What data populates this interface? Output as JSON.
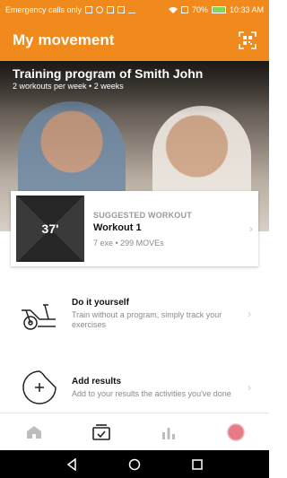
{
  "status_bar": {
    "carrier": "Emergency calls only",
    "battery": "70%",
    "time": "10:33 AM",
    "icons": [
      "usb-icon",
      "cloud-icon",
      "photo-icon",
      "mail-icon",
      "download-icon",
      "wifi-icon",
      "sim-icon",
      "battery-icon"
    ]
  },
  "appbar": {
    "title": "My movement",
    "scan_icon": "qr-scan-icon"
  },
  "hero": {
    "title": "Training program of Smith John",
    "subtitle": "2 workouts per week • 2 weeks"
  },
  "suggested": {
    "duration": "37'",
    "label": "SUGGESTED WORKOUT",
    "name": "Workout 1",
    "meta": "7 exe • 299 MOVEs"
  },
  "options": [
    {
      "title": "Do it yourself",
      "desc": "Train without a program, simply track your exercises",
      "icon": "exercise-bike-icon"
    },
    {
      "title": "Add results",
      "desc": "Add to your results the activities you've done",
      "icon": "add-circle-icon"
    }
  ],
  "tabs": [
    {
      "icon": "home-icon"
    },
    {
      "icon": "workout-icon",
      "selected": true
    },
    {
      "icon": "bar-chart-icon"
    },
    {
      "icon": "profile-icon"
    }
  ],
  "colors": {
    "primary": "#f08a1c",
    "profile_dot": "#e87a85"
  }
}
